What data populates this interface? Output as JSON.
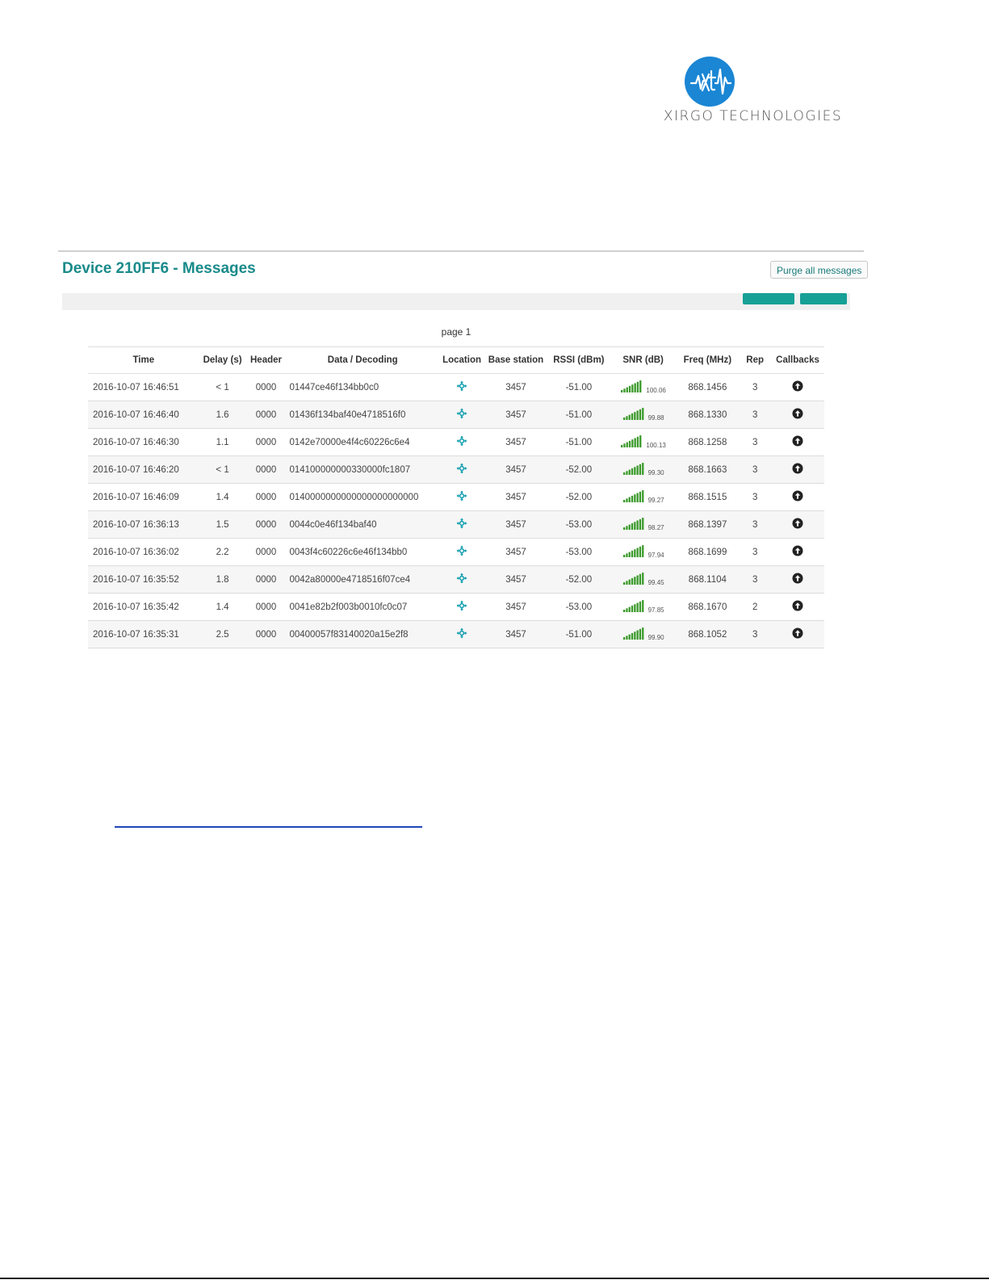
{
  "logo": {
    "text": "XIRGO TECHNOLOGIES",
    "color": "#1a86d4"
  },
  "page": {
    "title": "Device 210FF6 - Messages",
    "purge_label": "Purge all messages",
    "pagination_label": "page 1"
  },
  "table": {
    "headers": [
      "Time",
      "Delay (s)",
      "Header",
      "Data / Decoding",
      "Location",
      "Base station",
      "RSSI (dBm)",
      "SNR (dB)",
      "Freq (MHz)",
      "Rep",
      "Callbacks"
    ],
    "rows": [
      {
        "time": "2016-10-07 16:46:51",
        "delay": "< 1",
        "header": "0000",
        "data": "01447ce46f134bb0c0",
        "station": "3457",
        "rssi": "-51.00",
        "snr": "100.06",
        "freq": "868.1456",
        "rep": "3"
      },
      {
        "time": "2016-10-07 16:46:40",
        "delay": "1.6",
        "header": "0000",
        "data": "01436f134baf40e4718516f0",
        "station": "3457",
        "rssi": "-51.00",
        "snr": "99.88",
        "freq": "868.1330",
        "rep": "3"
      },
      {
        "time": "2016-10-07 16:46:30",
        "delay": "1.1",
        "header": "0000",
        "data": "0142e70000e4f4c60226c6e4",
        "station": "3457",
        "rssi": "-51.00",
        "snr": "100.13",
        "freq": "868.1258",
        "rep": "3"
      },
      {
        "time": "2016-10-07 16:46:20",
        "delay": "< 1",
        "header": "0000",
        "data": "014100000000330000fc1807",
        "station": "3457",
        "rssi": "-52.00",
        "snr": "99.30",
        "freq": "868.1663",
        "rep": "3"
      },
      {
        "time": "2016-10-07 16:46:09",
        "delay": "1.4",
        "header": "0000",
        "data": "0140000000000000000000000",
        "station": "3457",
        "rssi": "-52.00",
        "snr": "99.27",
        "freq": "868.1515",
        "rep": "3"
      },
      {
        "time": "2016-10-07 16:36:13",
        "delay": "1.5",
        "header": "0000",
        "data": "0044c0e46f134baf40",
        "station": "3457",
        "rssi": "-53.00",
        "snr": "98.27",
        "freq": "868.1397",
        "rep": "3"
      },
      {
        "time": "2016-10-07 16:36:02",
        "delay": "2.2",
        "header": "0000",
        "data": "0043f4c60226c6e46f134bb0",
        "station": "3457",
        "rssi": "-53.00",
        "snr": "97.94",
        "freq": "868.1699",
        "rep": "3"
      },
      {
        "time": "2016-10-07 16:35:52",
        "delay": "1.8",
        "header": "0000",
        "data": "0042a80000e4718516f07ce4",
        "station": "3457",
        "rssi": "-52.00",
        "snr": "99.45",
        "freq": "868.1104",
        "rep": "3"
      },
      {
        "time": "2016-10-07 16:35:42",
        "delay": "1.4",
        "header": "0000",
        "data": "0041e82b2f003b0010fc0c07",
        "station": "3457",
        "rssi": "-53.00",
        "snr": "97.85",
        "freq": "868.1670",
        "rep": "2"
      },
      {
        "time": "2016-10-07 16:35:31",
        "delay": "2.5",
        "header": "0000",
        "data": "00400057f83140020a15e2f8",
        "station": "3457",
        "rssi": "-51.00",
        "snr": "99.90",
        "freq": "868.1052",
        "rep": "3"
      }
    ]
  },
  "icons": {
    "location": "crosshair-move-icon",
    "snr": "signal-bars-icon",
    "callback": "arrow-up-circle-icon"
  },
  "colors": {
    "title": "#1a8a8a",
    "link": "#168c9e",
    "delay": "#5a8a0a",
    "toolbar_button": "#17a096",
    "signal": "#3a9a2a"
  }
}
